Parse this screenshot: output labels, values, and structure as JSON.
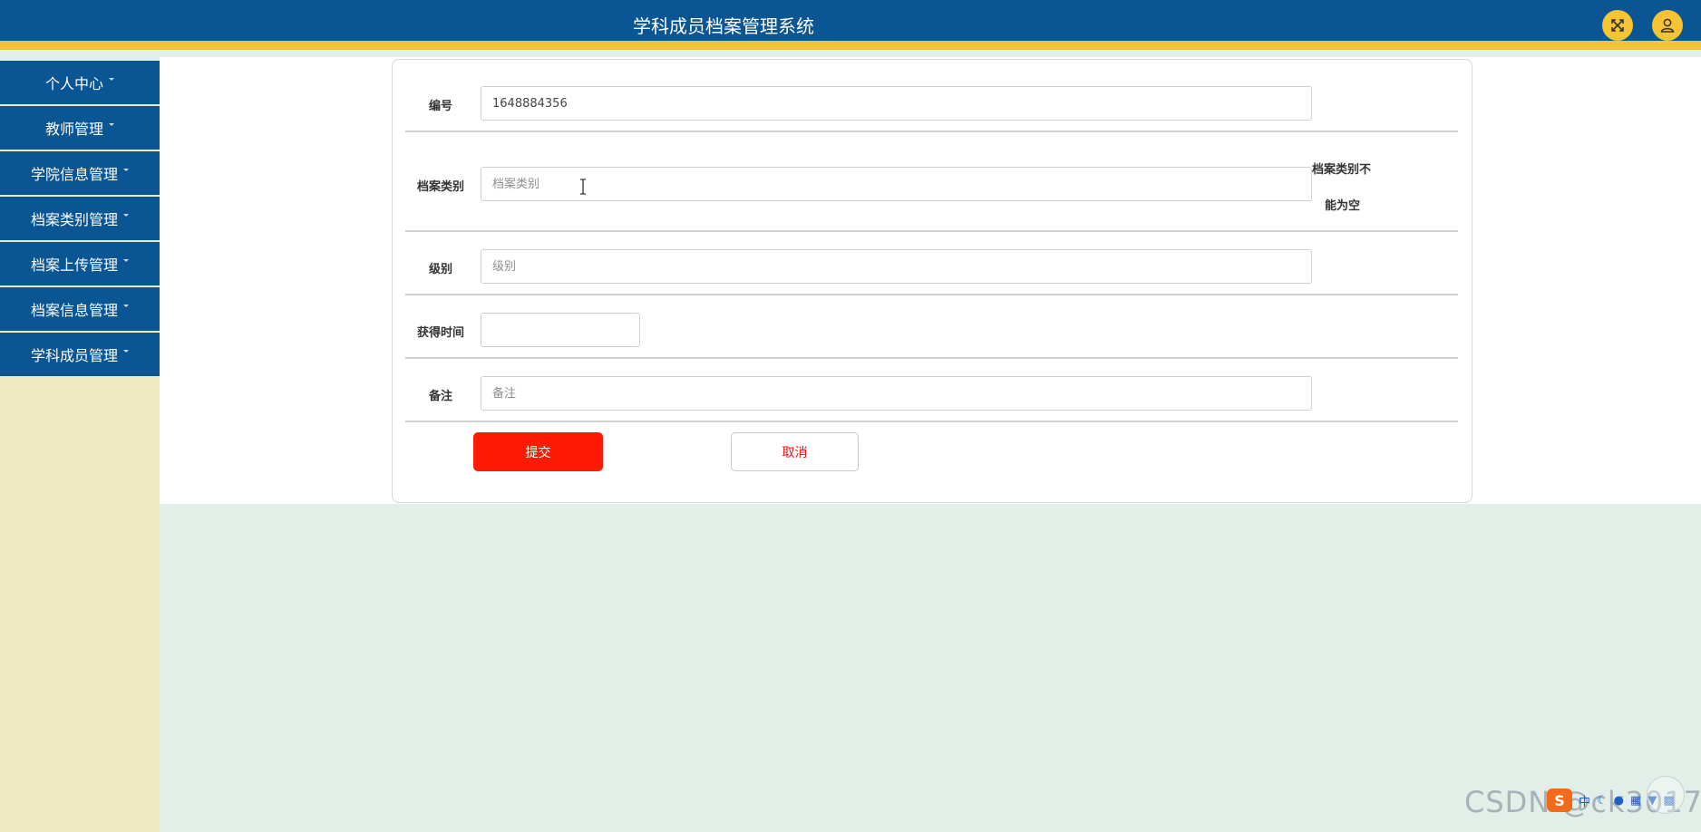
{
  "header": {
    "title": "学科成员档案管理系统",
    "icons": [
      "fullscreen-icon",
      "user-icon"
    ],
    "bar_color": "#0a5593",
    "stripe_color": "#f4c23a"
  },
  "sidebar": {
    "items": [
      {
        "label": "个人中心"
      },
      {
        "label": "教师管理"
      },
      {
        "label": "学院信息管理"
      },
      {
        "label": "档案类别管理"
      },
      {
        "label": "档案上传管理"
      },
      {
        "label": "档案信息管理"
      },
      {
        "label": "学科成员管理"
      }
    ]
  },
  "form": {
    "fields": [
      {
        "label": "编号",
        "value": "1648884356",
        "placeholder": ""
      },
      {
        "label": "档案类别",
        "value": "",
        "placeholder": "档案类别",
        "error_line1": "档案类别不",
        "error_line2": "能为空"
      },
      {
        "label": "级别",
        "value": "",
        "placeholder": "级别"
      },
      {
        "label": "获得时间",
        "value": "",
        "placeholder": ""
      },
      {
        "label": "备注",
        "value": "",
        "placeholder": "备注"
      }
    ],
    "submit_label": "提交",
    "cancel_label": "取消",
    "submit_color": "#ff1a06"
  },
  "overlay": {
    "watermark": "CSDN @ck3017",
    "ime_logo": "S",
    "ime_mode": "中",
    "ime_icons": [
      "moon-icon",
      "mic-icon",
      "keyboard-icon",
      "shirt-icon",
      "grid-icon"
    ]
  }
}
